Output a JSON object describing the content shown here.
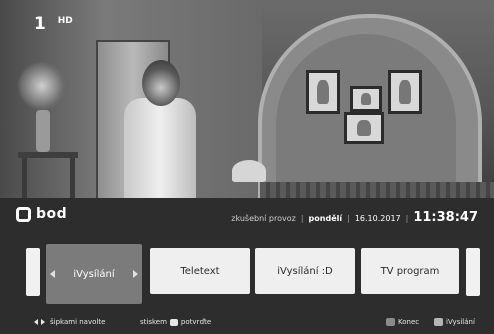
{
  "channel": {
    "logo": "1",
    "quality": "HD"
  },
  "brand": {
    "name": "bod"
  },
  "status": {
    "mode": "zkušební provoz",
    "separator": "|",
    "day": "pondělí",
    "date": "16.10.2017",
    "time": "11:38:47"
  },
  "menu": {
    "items": [
      {
        "label": "iVysílání",
        "active": true
      },
      {
        "label": "Teletext"
      },
      {
        "label": "iVysílání :D"
      },
      {
        "label": "TV program"
      }
    ]
  },
  "hints": {
    "navigate": "šipkami navolte",
    "confirm_prefix": "stiskem",
    "confirm_suffix": "potvrďte",
    "exit": "Konec",
    "ivysilani": "iVysílání"
  },
  "colors": {
    "overlay_bg": "#2d2d2d",
    "tile_bg": "#efefef",
    "tile_active_bg": "#7b7b7b",
    "exit_button": "#8a8a8a",
    "ivysilani_button": "#b5b5b5"
  }
}
